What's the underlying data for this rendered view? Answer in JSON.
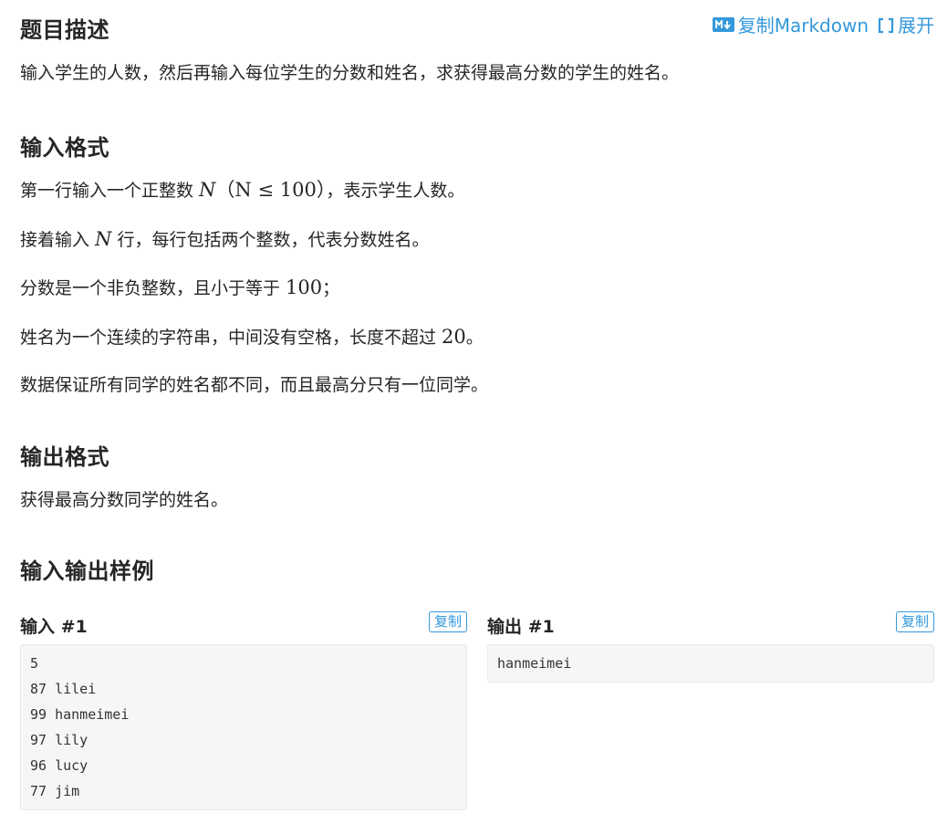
{
  "description": {
    "title": "题目描述",
    "copy_markdown": "复制Markdown",
    "expand": "展开",
    "text": "输入学生的人数，然后再输入每位学生的分数和姓名，求获得最高分数的学生的姓名。"
  },
  "input_format": {
    "title": "输入格式",
    "line1_pre": "第一行输入一个正整数 ",
    "line1_var": "N",
    "line1_math": "（N ≤ 100）",
    "line1_post": "，表示学生人数。",
    "line2_pre": "接着输入 ",
    "line2_var": "N",
    "line2_post": " 行，每行包括两个整数，代表分数姓名。",
    "line3_pre": "分数是一个非负整数，且小于等于 ",
    "line3_num": "100",
    "line3_post": "；",
    "line4_pre": "姓名为一个连续的字符串，中间没有空格，长度不超过 ",
    "line4_num": "20",
    "line4_post": "。",
    "line5": "数据保证所有同学的姓名都不同，而且最高分只有一位同学。"
  },
  "output_format": {
    "title": "输出格式",
    "text": "获得最高分数同学的姓名。"
  },
  "samples": {
    "title": "输入输出样例",
    "input_title": "输入 #1",
    "output_title": "输出 #1",
    "copy_label": "复制",
    "input_lines": [
      "5",
      "87 lilei",
      "99 hanmeimei",
      "97 lily",
      "96 lucy",
      "77 jim"
    ],
    "output_lines": [
      "hanmeimei"
    ]
  },
  "colors": {
    "accent": "#3498db",
    "text": "#262626",
    "code_bg": "#f6f6f6"
  }
}
